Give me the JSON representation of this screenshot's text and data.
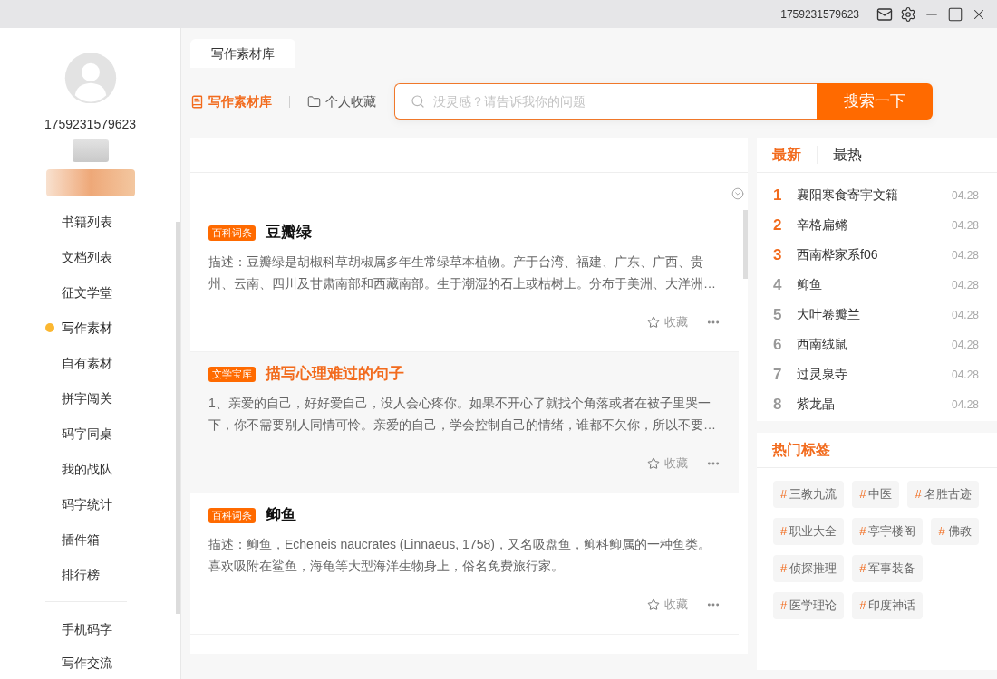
{
  "title_bar": {
    "username": "1759231579623"
  },
  "sidebar": {
    "username": "1759231579623",
    "nav_items": [
      {
        "label": "书籍列表",
        "selected": false
      },
      {
        "label": "文档列表",
        "selected": false
      },
      {
        "label": "征文学堂",
        "selected": false
      },
      {
        "label": "写作素材",
        "selected": true
      },
      {
        "label": "自有素材",
        "selected": false
      },
      {
        "label": "拼字闯关",
        "selected": false
      },
      {
        "label": "码字同桌",
        "selected": false
      },
      {
        "label": "我的战队",
        "selected": false
      },
      {
        "label": "码字统计",
        "selected": false
      },
      {
        "label": "插件箱",
        "selected": false
      },
      {
        "label": "排行榜",
        "selected": false
      }
    ],
    "extra_items": [
      {
        "label": "手机码字",
        "selected": false
      },
      {
        "label": "写作交流",
        "selected": false
      }
    ]
  },
  "tabs": [
    {
      "label": "写作素材库",
      "selected": true
    }
  ],
  "sub_nav": [
    {
      "kind": "library",
      "label": "写作素材库",
      "selected": true
    },
    {
      "kind": "favorites",
      "label": "个人收藏",
      "selected": false
    }
  ],
  "search": {
    "placeholder": "没灵感？请告诉我你的问题",
    "button": "搜索一下"
  },
  "materials": [
    {
      "badge": "百科词条",
      "title": "豆瓣绿",
      "description": "描述：豆瓣绿是胡椒科草胡椒属多年生常绿草本植物。产于台湾、福建、广东、广西、贵州、云南、四川及甘肃南部和西藏南部。生于潮湿的石上或枯树上。分布于美洲、大洋洲…",
      "favorite_label": "收藏",
      "highlighted": false
    },
    {
      "badge": "文学宝库",
      "title": "描写心理难过的句子",
      "description": "1、亲爱的自己，好好爱自己，没人会心疼你。如果不开心了就找个角落或者在被子里哭一下，你不需要别人同情可怜。亲爱的自己，学会控制自己的情绪，谁都不欠你，所以不要…",
      "favorite_label": "收藏",
      "highlighted": true
    },
    {
      "badge": "百科词条",
      "title": "䲟鱼",
      "description": "描述：䲟鱼，Echeneis naucrates (Linnaeus, 1758)，又名吸盘鱼，䲟科䲟属的一种鱼类。喜欢吸附在鲨鱼，海龟等大型海洋生物身上，俗名免费旅行家。",
      "favorite_label": "收藏",
      "highlighted": false
    }
  ],
  "latest": {
    "tabs": [
      {
        "label": "最新",
        "selected": true
      },
      {
        "label": "最热",
        "selected": false
      }
    ],
    "items": [
      {
        "rank": "1",
        "title": "襄阳寒食寄宇文籍",
        "date": "04.28",
        "color": "#f26b1d"
      },
      {
        "rank": "2",
        "title": "辛格扁鳉",
        "date": "04.28",
        "color": "#f26b1d"
      },
      {
        "rank": "3",
        "title": "西南桦家系f06",
        "date": "04.28",
        "color": "#f26b1d"
      },
      {
        "rank": "4",
        "title": "䲟鱼",
        "date": "04.28",
        "color": "#999999"
      },
      {
        "rank": "5",
        "title": "大叶卷瓣兰",
        "date": "04.28",
        "color": "#999999"
      },
      {
        "rank": "6",
        "title": "西南绒鼠",
        "date": "04.28",
        "color": "#999999"
      },
      {
        "rank": "7",
        "title": "过灵泉寺",
        "date": "04.28",
        "color": "#999999"
      },
      {
        "rank": "8",
        "title": "紫龙晶",
        "date": "04.28",
        "color": "#999999"
      }
    ]
  },
  "hot_tags": {
    "title": "热门标签",
    "tags": [
      {
        "prefix": "#",
        "label": "三教九流"
      },
      {
        "prefix": "#",
        "label": "中医"
      },
      {
        "prefix": "#",
        "label": "名胜古迹"
      },
      {
        "prefix": "#",
        "label": "职业大全"
      },
      {
        "prefix": "#",
        "label": "亭宇楼阁"
      },
      {
        "prefix": "#",
        "label": "佛教"
      },
      {
        "prefix": "#",
        "label": "侦探推理"
      },
      {
        "prefix": "#",
        "label": "军事装备"
      },
      {
        "prefix": "#",
        "label": "医学理论"
      },
      {
        "prefix": "#",
        "label": "印度神话"
      }
    ]
  }
}
